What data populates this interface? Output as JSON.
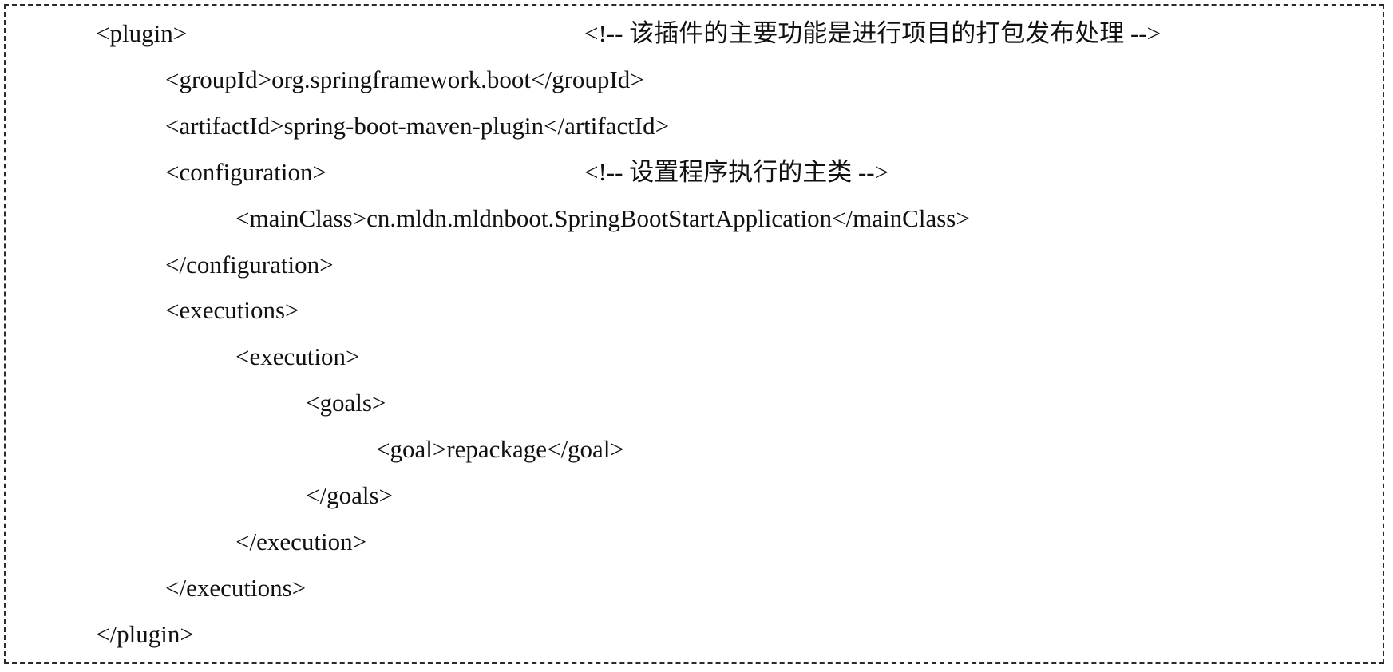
{
  "code": {
    "lines": [
      {
        "text": "<plugin>",
        "comment": "<!-- 该插件的主要功能是进行项目的打包发布处理 -->"
      },
      {
        "text": "<groupId>org.springframework.boot</groupId>"
      },
      {
        "text": "<artifactId>spring-boot-maven-plugin</artifactId>"
      },
      {
        "text": "<configuration>",
        "comment": "<!-- 设置程序执行的主类 -->"
      },
      {
        "text": "<mainClass>cn.mldn.mldnboot.SpringBootStartApplication</mainClass>"
      },
      {
        "text": "</configuration>"
      },
      {
        "text": "<executions>"
      },
      {
        "text": "<execution>"
      },
      {
        "text": "<goals>"
      },
      {
        "text": "<goal>repackage</goal>"
      },
      {
        "text": "</goals>"
      },
      {
        "text": "</execution>"
      },
      {
        "text": "</executions>"
      },
      {
        "text": "</plugin>"
      }
    ]
  }
}
